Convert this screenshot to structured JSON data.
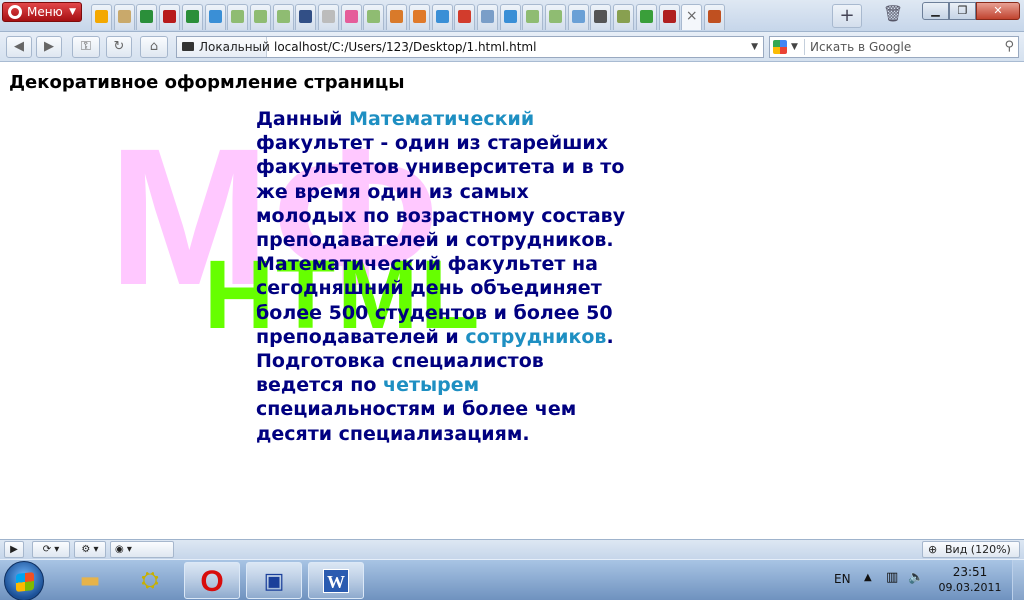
{
  "browser": {
    "menu_label": "Меню",
    "tab_icon_colors": [
      "#f4a800",
      "#c9a96b",
      "#2b8f3a",
      "#b81b1b",
      "#2b8f3a",
      "#3a8fd6",
      "#8fbc72",
      "#8fbc72",
      "#8fbc72",
      "#324f86",
      "#bcbcbc",
      "#e55d9a",
      "#8fbc72",
      "#d97a2a",
      "#e07a2a",
      "#3a8fd6",
      "#d23c2c",
      "#7a9ec8",
      "#3a8fd6",
      "#8fbc72",
      "#8fbc72",
      "#6aa0d6",
      "#555555",
      "#88a050",
      "#3a9f3a",
      "#b02020",
      "#c05020"
    ],
    "active_tab_close": "×",
    "new_tab_label": "+",
    "address": {
      "site_label": "Локальный",
      "url": "localhost/C:/Users/123/Desktop/1.html.html"
    },
    "search": {
      "placeholder": "Искать в Google"
    },
    "zoom_label": "Вид (120%)"
  },
  "page": {
    "title": "Декоративное оформление страницы",
    "decor_back": "МФ",
    "decor_front": "HTML",
    "paragraph": {
      "t1": "Данный ",
      "h1": "Математический",
      "t2": " факультет - один из старейших факультетов университета и в то же время один из самых молодых по возрастному составу преподавателей и сотрудников. Математический факультет на сегодняшний день объединяет более 500 студентов и более 50 преподавателей и ",
      "h2": "сотрудников",
      "t3": ". Подготовка специалистов ведется по ",
      "h3": "четырем",
      "t4": " специальностям и более чем десяти специализациям."
    },
    "colors": {
      "text": "#000080",
      "highlight": "#1e8fc2",
      "decor_back": "#ffc8ff",
      "decor_front": "#66ff00"
    }
  },
  "taskbar": {
    "language": "EN",
    "time": "23:51",
    "date": "09.03.2011"
  }
}
